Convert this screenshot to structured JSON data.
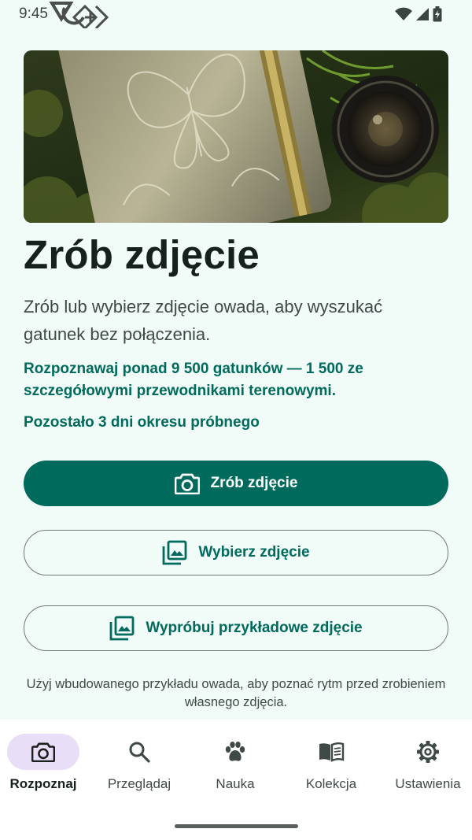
{
  "status_bar": {
    "time": "9:45"
  },
  "main": {
    "title": "Zrób zdjęcie",
    "description": "Zrób lub wybierz zdjęcie owada, aby wyszukać gatunek bez połączenia.",
    "highlight": "Rozpoznawaj ponad 9 500 gatunków — 1 500 ze szczegółowymi przewodnikami terenowymi.",
    "trial": "Pozostało 3 dni okresu próbnego",
    "take_photo_label": "Zrób zdjęcie",
    "choose_photo_label": "Wybierz zdjęcie",
    "sample_photo_label": "Wypróbuj przykładowe zdjęcie",
    "hint": "Użyj wbudowanego przykładu owada, aby poznać rytm przed zrobieniem własnego zdjęcia."
  },
  "nav": {
    "items": [
      {
        "label": "Rozpoznaj",
        "icon": "camera-icon",
        "active": true
      },
      {
        "label": "Przeglądaj",
        "icon": "search-icon",
        "active": false
      },
      {
        "label": "Nauka",
        "icon": "paw-icon",
        "active": false
      },
      {
        "label": "Kolekcja",
        "icon": "book-icon",
        "active": false
      },
      {
        "label": "Ustawienia",
        "icon": "gear-icon",
        "active": false
      }
    ]
  },
  "colors": {
    "primary": "#006b5c",
    "background": "#f1fbf8",
    "active_pill": "#e8def8"
  }
}
